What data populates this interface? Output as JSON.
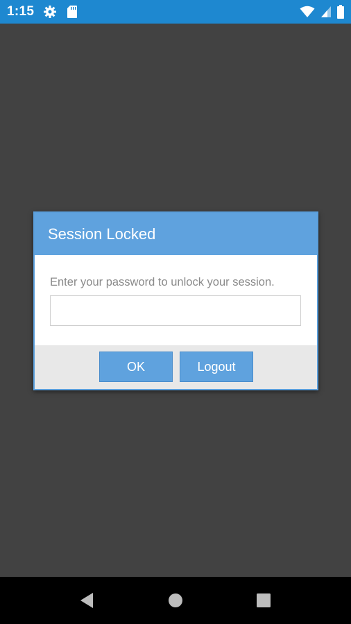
{
  "status_bar": {
    "time": "1:15",
    "background_color": "#1e88d0",
    "left_icons": [
      "gear-icon",
      "sd-card-icon"
    ],
    "right_icons": [
      "wifi-icon",
      "cellular-signal-icon",
      "battery-icon"
    ]
  },
  "dialog": {
    "title": "Session Locked",
    "message": "Enter your password to unlock your session.",
    "password_value": "",
    "ok_label": "OK",
    "logout_label": "Logout",
    "header_color": "#5fa2de",
    "button_color": "#5fa2de"
  },
  "nav_bar": {
    "icons": [
      "back-icon",
      "home-icon",
      "recents-icon"
    ]
  }
}
